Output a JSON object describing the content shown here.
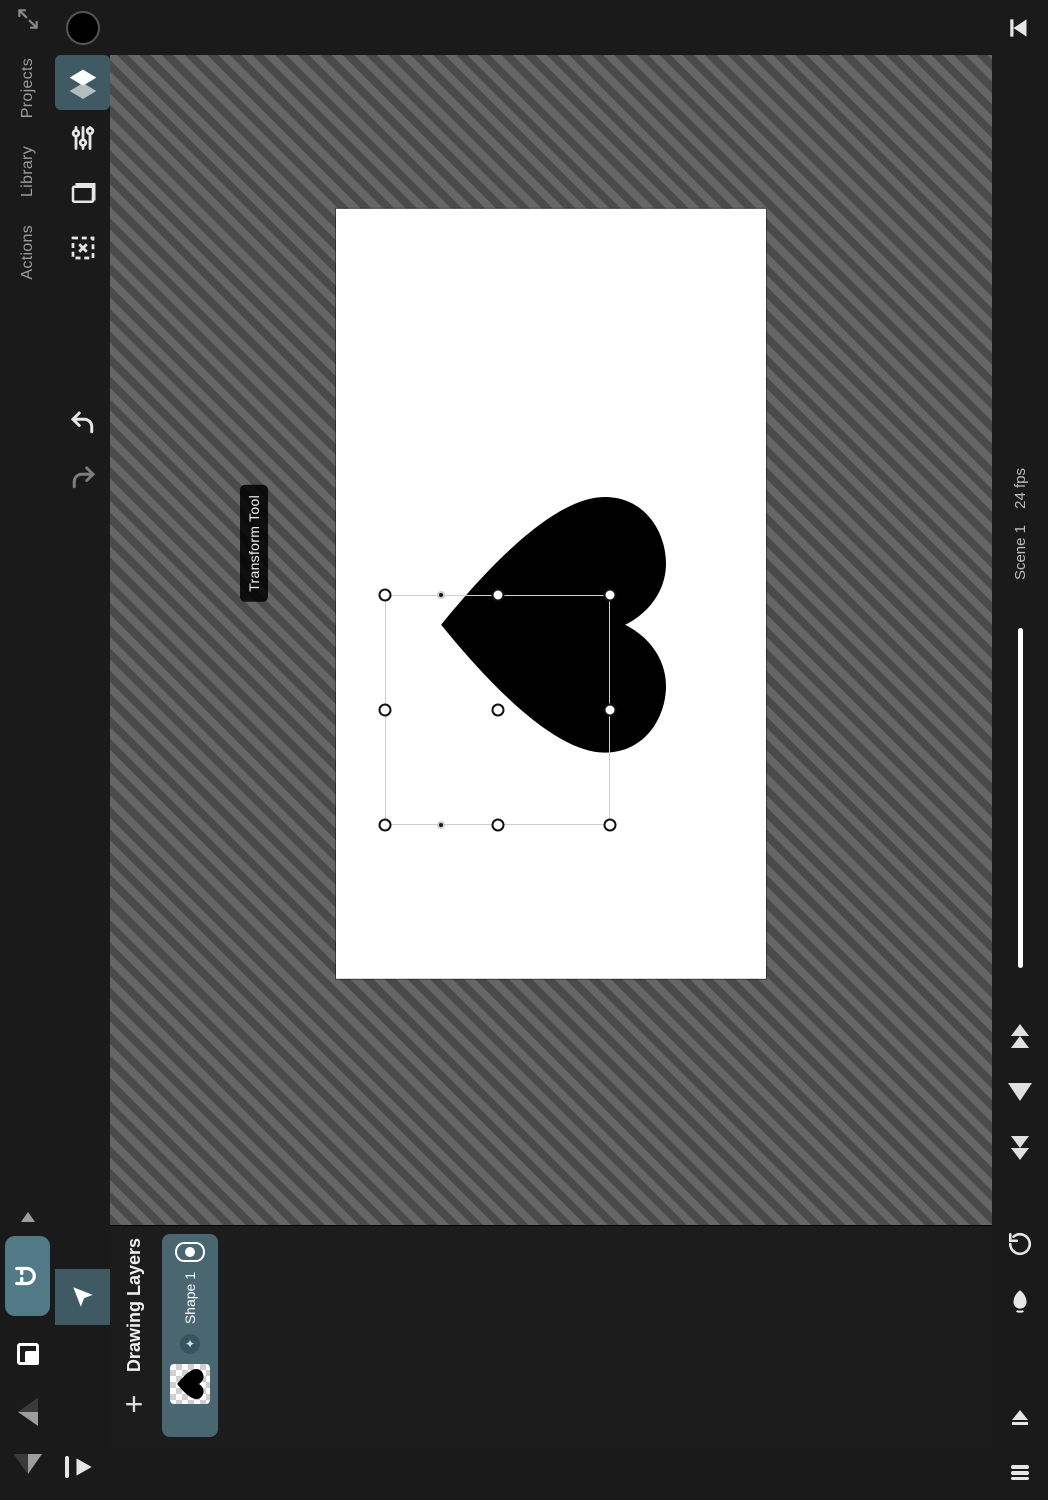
{
  "topnav": {
    "tabs": [
      "Projects",
      "Library",
      "Actions"
    ],
    "magnet_on": true
  },
  "tooltip": "Transform Tool",
  "layers_panel": {
    "title": "Drawing Layers",
    "add_label": "+",
    "layer_name": "Shape 1"
  },
  "timeline": {
    "scene_label": "Scene 1",
    "fps_label": "24 fps"
  },
  "colors": {
    "accent": "#4a6670",
    "canvas_bg": "#ffffff"
  },
  "tools": {
    "row2": [
      "color",
      "layers-stack",
      "sliders",
      "flipbook",
      "crop"
    ],
    "paint": [
      "transform",
      "select",
      "brush",
      "eraser",
      "fill",
      "smudge",
      "eyedropper",
      "ruler",
      "pen"
    ]
  }
}
